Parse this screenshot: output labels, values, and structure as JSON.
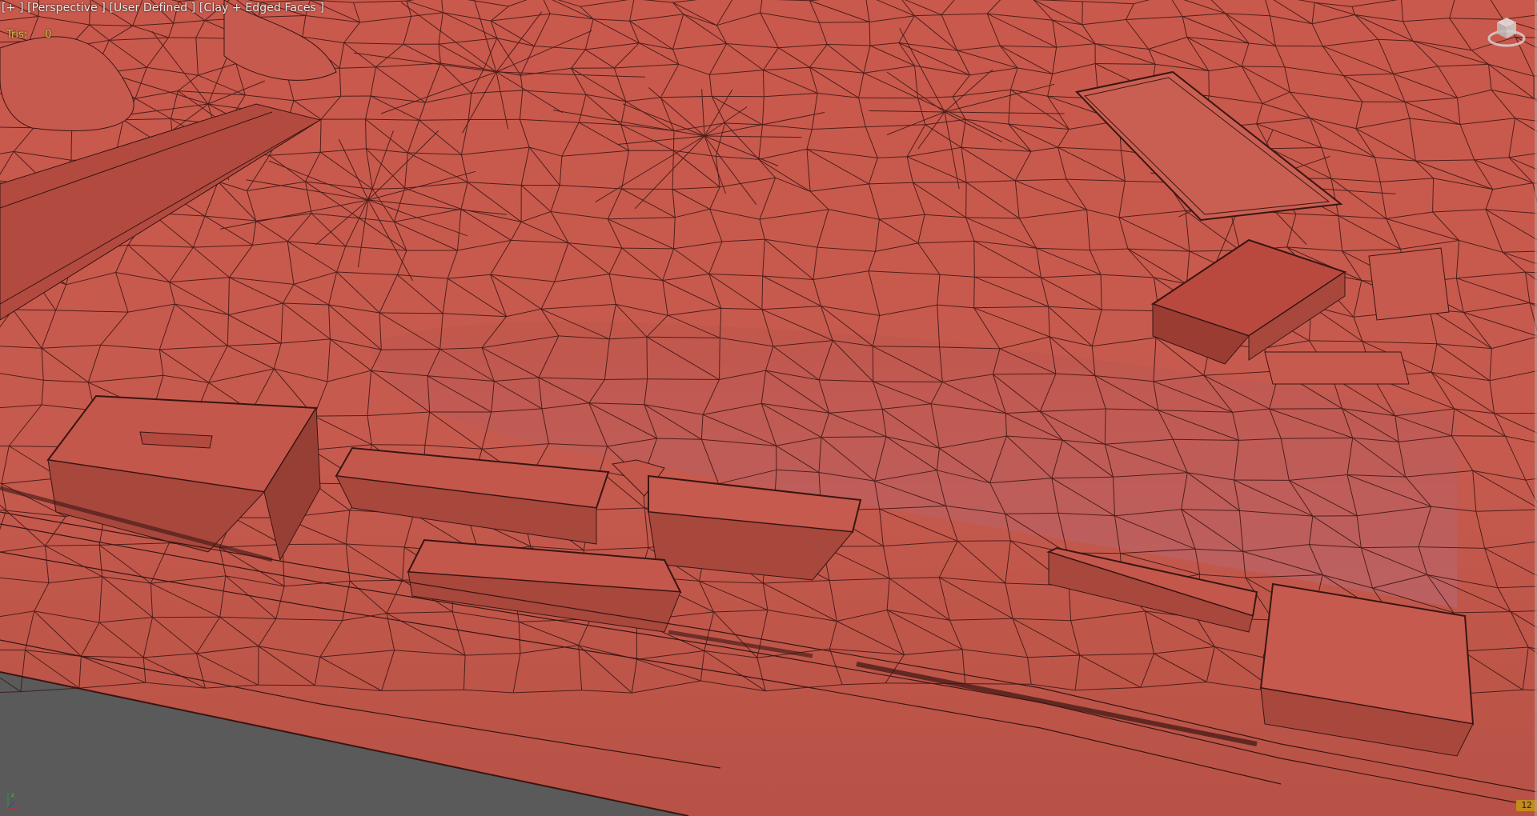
{
  "viewport": {
    "menu_label": "[+ ]",
    "view_label": "[Perspective ]",
    "camera_label": "[User Defined ]",
    "shading_label": "[Clay + Edged Faces ]"
  },
  "stats": {
    "tris_label": "Tris:",
    "tris_value": "0"
  },
  "status": {
    "frame_badge": "12"
  },
  "colors": {
    "clay": "#c65a4e",
    "clay_light": "#d06a5c",
    "clay_dark": "#a8473c",
    "edge": "#3a1512",
    "ground_plane": "#5a5a5a",
    "hud_text": "#e8e8e8",
    "stats_text": "#d9c24a"
  },
  "icons": {
    "viewcube": "viewcube-icon",
    "axis_tripod": "axis-tripod-icon"
  }
}
